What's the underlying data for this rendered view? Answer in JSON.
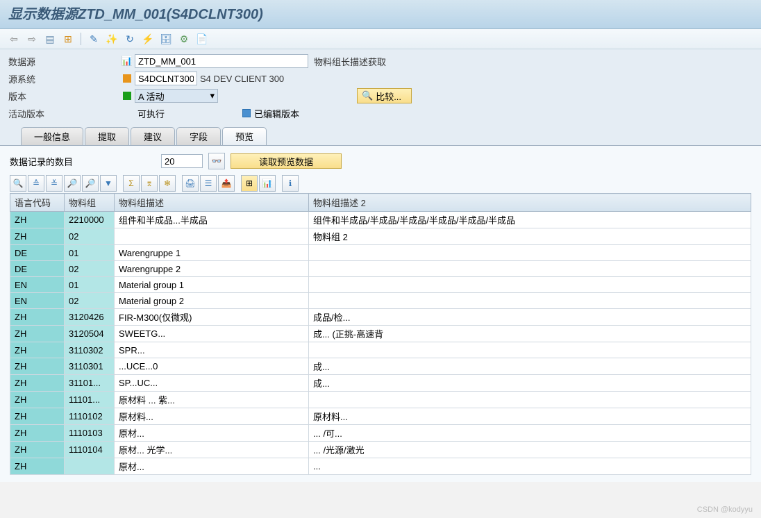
{
  "title": "显示数据源ZTD_MM_001(S4DCLNT300)",
  "form": {
    "datasource_label": "数据源",
    "datasource_value": "ZTD_MM_001",
    "datasource_desc": "物料组长描述获取",
    "sourcesys_label": "源系统",
    "sourcesys_value": "S4DCLNT300",
    "sourcesys_desc": "S4 DEV CLIENT 300",
    "version_label": "版本",
    "version_value": "A 活动",
    "compare_btn": "比较...",
    "active_version_label": "活动版本",
    "executable": "可执行",
    "edited_version": "已编辑版本"
  },
  "tabs": [
    "一般信息",
    "提取",
    "建议",
    "字段",
    "预览"
  ],
  "active_tab": 4,
  "records": {
    "label": "数据记录的数目",
    "value": "20",
    "read_btn": "读取预览数据"
  },
  "table": {
    "headers": [
      "语言代码",
      "物料组",
      "物料组描述",
      "物料组描述 2"
    ],
    "rows": [
      {
        "lang": "ZH",
        "grp": "2210000",
        "d1": "组件和半成品...半成品",
        "d2": "组件和半成品/半成品/半成品/半成品/半成品/半成品"
      },
      {
        "lang": "ZH",
        "grp": "02",
        "d1": "",
        "d2": "物料组 2"
      },
      {
        "lang": "DE",
        "grp": "01",
        "d1": "Warengruppe 1",
        "d2": ""
      },
      {
        "lang": "DE",
        "grp": "02",
        "d1": "Warengruppe 2",
        "d2": ""
      },
      {
        "lang": "EN",
        "grp": "01",
        "d1": "Material group 1",
        "d2": ""
      },
      {
        "lang": "EN",
        "grp": "02",
        "d1": "Material group 2",
        "d2": ""
      },
      {
        "lang": "ZH",
        "grp": "3120426",
        "d1": "FIR-M300(仅微观)",
        "d2": "成品/检..."
      },
      {
        "lang": "ZH",
        "grp": "3120504",
        "d1": "SWEETG...",
        "d2": "成... (正挑-高速背"
      },
      {
        "lang": "ZH",
        "grp": "3110302",
        "d1": "SPR...",
        "d2": ""
      },
      {
        "lang": "ZH",
        "grp": "3110301",
        "d1": "...UCE...0",
        "d2": "成..."
      },
      {
        "lang": "ZH",
        "grp": "31101...",
        "d1": "SP...UC...",
        "d2": "成..."
      },
      {
        "lang": "ZH",
        "grp": "11101...",
        "d1": "原材料 ... 紫...",
        "d2": ""
      },
      {
        "lang": "ZH",
        "grp": "1110102",
        "d1": "原材料...",
        "d2": "原材料..."
      },
      {
        "lang": "ZH",
        "grp": "1110103",
        "d1": "原材...",
        "d2": "... /可..."
      },
      {
        "lang": "ZH",
        "grp": "1110104",
        "d1": "原材... 光学...",
        "d2": "... /光源/激光"
      },
      {
        "lang": "ZH",
        "grp": "",
        "d1": "原材...",
        "d2": "..."
      }
    ]
  },
  "watermark": "CSDN @kodyyu"
}
